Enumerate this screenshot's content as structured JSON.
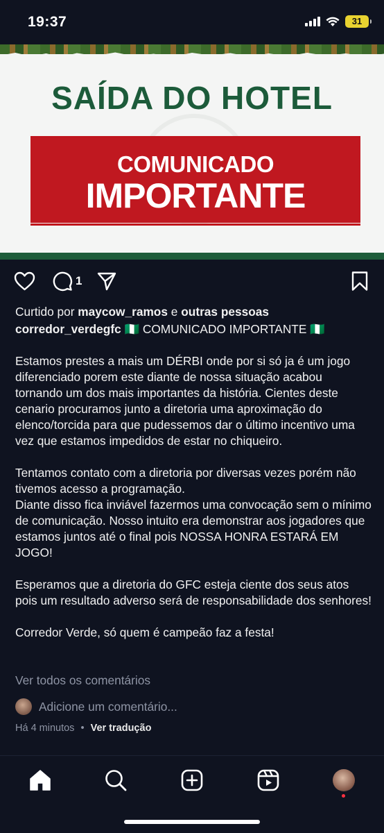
{
  "status_bar": {
    "time": "19:37",
    "battery": "31"
  },
  "post": {
    "image": {
      "headline": "SAÍDA DO HOTEL",
      "banner_line1": "COMUNICADO",
      "banner_line2": "IMPORTANTE",
      "colors": {
        "headline": "#1c5b3a",
        "banner": "#c01820"
      }
    },
    "comment_count": "1",
    "likes": {
      "prefix": "Curtido por ",
      "user": "maycow_ramos",
      "connector": " e ",
      "others": "outras pessoas"
    },
    "caption": {
      "username": "corredor_verdegfc",
      "flag": "🇳🇬",
      "title": "COMUNICADO IMPORTANTE",
      "paragraphs": [
        "Estamos prestes a mais um DÉRBI onde por si só ja é um jogo diferenciado porem este diante de nossa situação acabou tornando um dos mais importantes da história. Cientes deste cenario procuramos junto a diretoria uma aproximação do elenco/torcida para que pudessemos dar o último incentivo uma vez que estamos impedidos de estar no chiqueiro.",
        "Tentamos contato com a diretoria por diversas vezes porém não tivemos acesso a programação.\nDiante disso fica inviável fazermos uma convocação sem o mínimo de comunicação. Nosso intuito era demonstrar aos jogadores que estamos juntos até o final pois NOSSA HONRA ESTARÁ EM JOGO!",
        "Esperamos que a diretoria do GFC esteja ciente dos seus atos pois um resultado adverso será de responsabilidade dos senhores!",
        "Corredor Verde, só quem é campeão faz a festa!"
      ]
    },
    "view_comments": "Ver todos os comentários",
    "add_comment_placeholder": "Adicione um comentário...",
    "time_ago": "Há 4 minutos",
    "separator": "•",
    "translate": "Ver tradução"
  },
  "icons": {
    "like": "heart-icon",
    "comment": "comment-icon",
    "share": "send-icon",
    "save": "bookmark-icon",
    "nav": [
      "home-icon",
      "search-icon",
      "create-icon",
      "reels-icon",
      "profile-avatar"
    ]
  }
}
